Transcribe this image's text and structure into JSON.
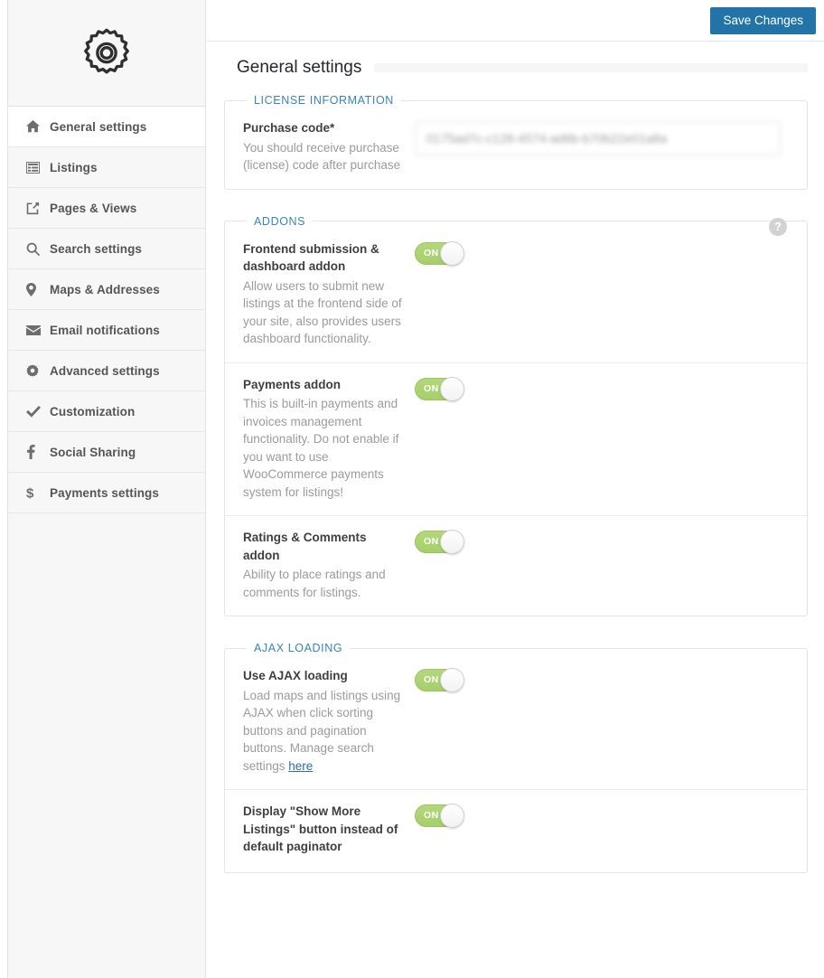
{
  "sidebar": {
    "logo_icon": "gear-icon",
    "items": [
      {
        "label": "General settings",
        "icon": "home-icon",
        "active": true
      },
      {
        "label": "Listings",
        "icon": "list-icon",
        "active": false
      },
      {
        "label": "Pages & Views",
        "icon": "external-link-icon",
        "active": false
      },
      {
        "label": "Search settings",
        "icon": "search-icon",
        "active": false
      },
      {
        "label": "Maps & Addresses",
        "icon": "map-pin-icon",
        "active": false
      },
      {
        "label": "Email notifications",
        "icon": "envelope-icon",
        "active": false
      },
      {
        "label": "Advanced settings",
        "icon": "gear-icon",
        "active": false
      },
      {
        "label": "Customization",
        "icon": "check-icon",
        "active": false
      },
      {
        "label": "Social Sharing",
        "icon": "facebook-icon",
        "active": false
      },
      {
        "label": "Payments settings",
        "icon": "dollar-icon",
        "active": false
      }
    ]
  },
  "topbar": {
    "save_label": "Save Changes",
    "save_color": "#2273a8"
  },
  "page": {
    "title": "General settings"
  },
  "license": {
    "legend": "LICENSE INFORMATION",
    "purchase_code": {
      "title": "Purchase code*",
      "desc": "You should receive purchase (license) code after purchase",
      "value": "0175ad7c-c128-4574-ad6b-b70b22e01a8a",
      "placeholder": ""
    }
  },
  "addons": {
    "legend": "ADDONS",
    "help_icon": "question-mark-icon",
    "rows": [
      {
        "title": "Frontend submission & dashboard addon",
        "desc": "Allow users to submit new listings at the frontend side of your site, also provides users dashboard functionality.",
        "toggle": "ON"
      },
      {
        "title": "Payments addon",
        "desc": "This is built-in payments and invoices management functionality. Do not enable if you want to use WooCommerce payments system for listings!",
        "toggle": "ON"
      },
      {
        "title": "Ratings & Comments addon",
        "desc": "Ability to place ratings and comments for listings.",
        "toggle": "ON"
      }
    ]
  },
  "ajax": {
    "legend": "AJAX LOADING",
    "rows": [
      {
        "title": "Use AJAX loading",
        "desc_before": "Load maps and listings using AJAX when click sorting buttons and pagination buttons. Manage search settings ",
        "desc_link": "here",
        "toggle": "ON"
      },
      {
        "title": "Display \"Show More Listings\" button instead of default paginator",
        "desc": "",
        "toggle": "ON"
      }
    ]
  },
  "colors": {
    "accent_blue": "#3885b5",
    "toggle_green": "#a6cf69",
    "link_blue": "#2b6fa5"
  }
}
